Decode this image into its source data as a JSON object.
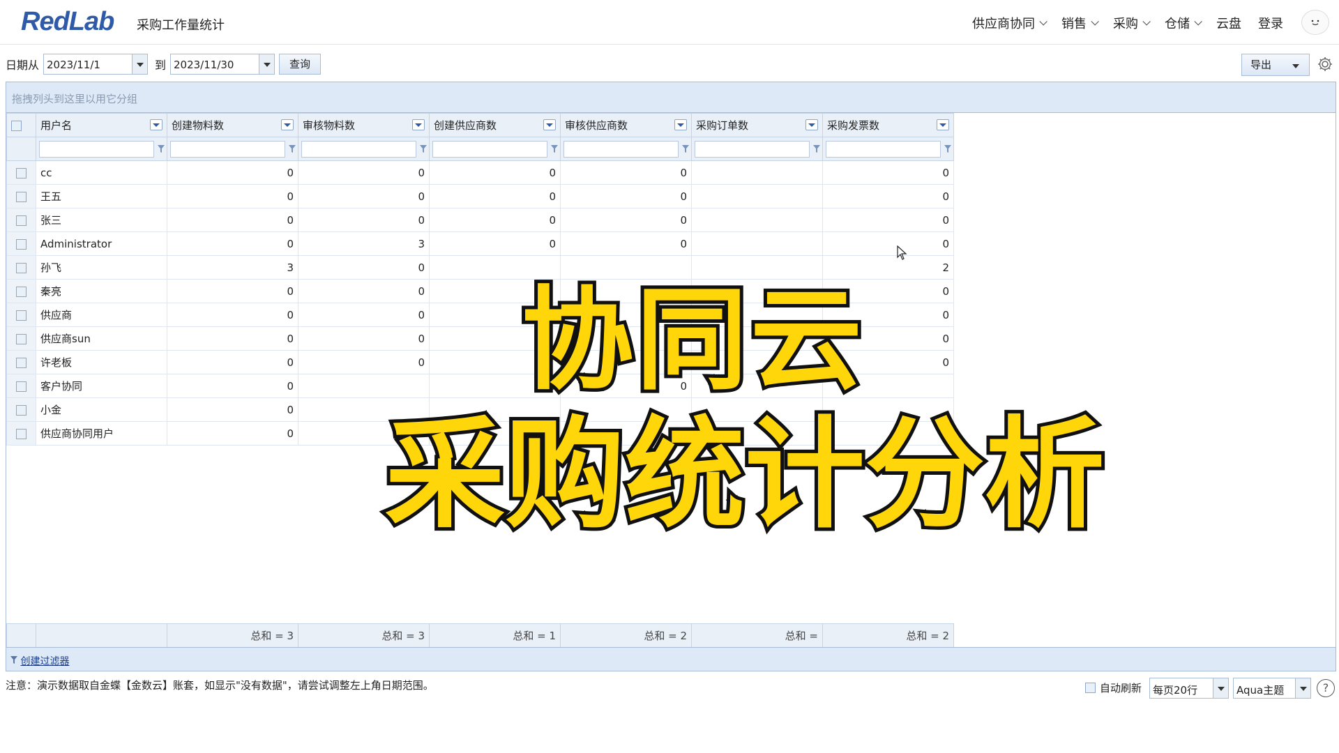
{
  "header": {
    "logo": "RedLab",
    "page_title": "采购工作量统计",
    "nav": [
      {
        "label": "供应商协同",
        "has_dropdown": true
      },
      {
        "label": "销售",
        "has_dropdown": true
      },
      {
        "label": "采购",
        "has_dropdown": true
      },
      {
        "label": "仓储",
        "has_dropdown": true
      },
      {
        "label": "云盘",
        "has_dropdown": false
      },
      {
        "label": "登录",
        "has_dropdown": false
      }
    ]
  },
  "toolbar": {
    "date_from_label": "日期从",
    "date_from": "2023/11/1",
    "date_to_label": "到",
    "date_to": "2023/11/30",
    "query_label": "查询",
    "export_label": "导出"
  },
  "grid": {
    "group_panel_hint": "拖拽列头到这里以用它分组",
    "columns": [
      "用户名",
      "创建物料数",
      "审核物料数",
      "创建供应商数",
      "审核供应商数",
      "采购订单数",
      "采购发票数"
    ],
    "rows": [
      {
        "name": "cc",
        "c1": "0",
        "c2": "0",
        "c3": "0",
        "c4": "0",
        "c5": "",
        "c6": "0"
      },
      {
        "name": "王五",
        "c1": "0",
        "c2": "0",
        "c3": "0",
        "c4": "0",
        "c5": "",
        "c6": "0"
      },
      {
        "name": "张三",
        "c1": "0",
        "c2": "0",
        "c3": "0",
        "c4": "0",
        "c5": "",
        "c6": "0"
      },
      {
        "name": "Administrator",
        "c1": "0",
        "c2": "3",
        "c3": "0",
        "c4": "0",
        "c5": "",
        "c6": "0"
      },
      {
        "name": "孙飞",
        "c1": "3",
        "c2": "0",
        "c3": "",
        "c4": "",
        "c5": "",
        "c6": "2"
      },
      {
        "name": "秦亮",
        "c1": "0",
        "c2": "0",
        "c3": "",
        "c4": "",
        "c5": "",
        "c6": "0"
      },
      {
        "name": "供应商",
        "c1": "0",
        "c2": "0",
        "c3": "",
        "c4": "",
        "c5": "",
        "c6": "0"
      },
      {
        "name": "供应商sun",
        "c1": "0",
        "c2": "0",
        "c3": "",
        "c4": "",
        "c5": "",
        "c6": "0"
      },
      {
        "name": "许老板",
        "c1": "0",
        "c2": "0",
        "c3": "",
        "c4": "",
        "c5": "",
        "c6": "0"
      },
      {
        "name": "客户协同",
        "c1": "0",
        "c2": "",
        "c3": "0",
        "c4": "0",
        "c5": "",
        "c6": ""
      },
      {
        "name": "小金",
        "c1": "0",
        "c2": "",
        "c3": "",
        "c4": "",
        "c5": "",
        "c6": ""
      },
      {
        "name": "供应商协同用户",
        "c1": "0",
        "c2": "",
        "c3": "",
        "c4": "",
        "c5": "",
        "c6": ""
      }
    ],
    "footer": [
      "总和 = 3",
      "总和 = 3",
      "总和 = 1",
      "总和 = 2",
      "总和 =",
      "总和 = 2"
    ],
    "create_filter_label": "创建过滤器"
  },
  "status": {
    "note": "注意：演示数据取自金蝶【金数云】账套，如显示\"没有数据\"，请尝试调整左上角日期范围。",
    "auto_refresh_label": "自动刷新",
    "page_size": "每页20行",
    "theme": "Aqua主题",
    "help": "?"
  },
  "overlay": {
    "line1": "协同云",
    "line2": "采购统计分析"
  }
}
